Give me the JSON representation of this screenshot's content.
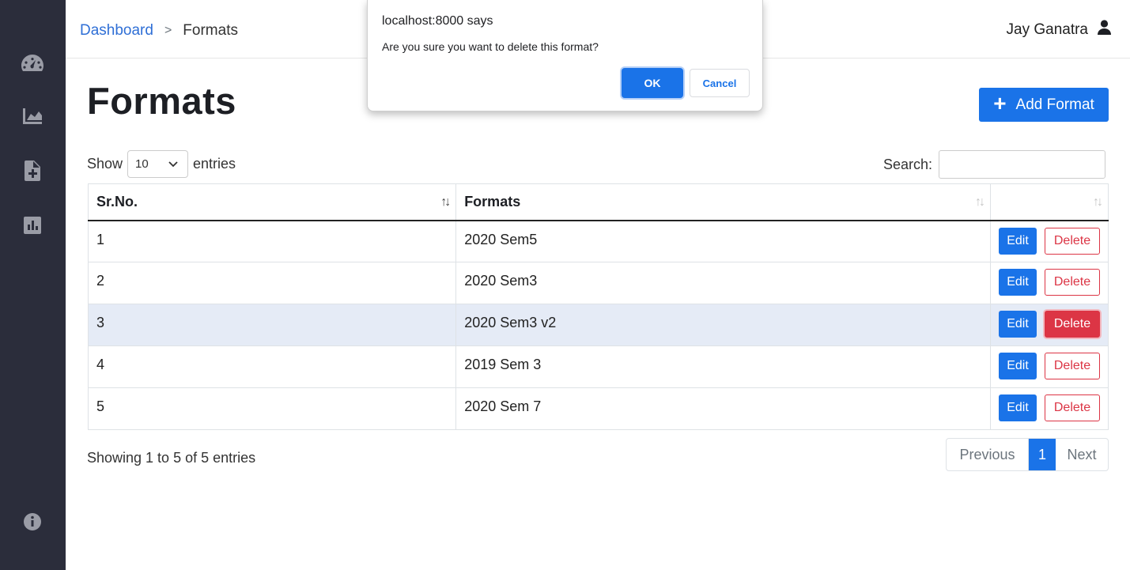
{
  "sidebar": {
    "icons": [
      "speedometer-icon",
      "area-chart-icon",
      "file-plus-icon",
      "bar-chart-icon",
      "info-icon"
    ]
  },
  "topbar": {
    "breadcrumb": {
      "link": "Dashboard",
      "separator": ">",
      "current": "Formats"
    },
    "user_name": "Jay Ganatra"
  },
  "page": {
    "title": "Formats",
    "add_button": "Add Format"
  },
  "table_controls": {
    "show_label": "Show",
    "entries_value": "10",
    "entries_label": "entries",
    "search_label": "Search:",
    "search_value": ""
  },
  "table": {
    "headers": [
      "Sr.No.",
      "Formats",
      ""
    ],
    "rows": [
      {
        "sr": "1",
        "format": "2020 Sem5",
        "edit": "Edit",
        "delete": "Delete"
      },
      {
        "sr": "2",
        "format": "2020 Sem3",
        "edit": "Edit",
        "delete": "Delete"
      },
      {
        "sr": "3",
        "format": "2020 Sem3 v2",
        "edit": "Edit",
        "delete": "Delete"
      },
      {
        "sr": "4",
        "format": "2019 Sem 3",
        "edit": "Edit",
        "delete": "Delete"
      },
      {
        "sr": "5",
        "format": "2020 Sem 7",
        "edit": "Edit",
        "delete": "Delete"
      }
    ],
    "selected_row": 3
  },
  "footer": {
    "info": "Showing 1 to 5 of 5 entries",
    "previous": "Previous",
    "page": "1",
    "next": "Next"
  },
  "dialog": {
    "title": "localhost:8000 says",
    "message": "Are you sure you want to delete this format?",
    "ok": "OK",
    "cancel": "Cancel"
  },
  "colors": {
    "sidebar_bg": "#2b2d3b",
    "primary": "#1a73e8",
    "danger": "#dc3545",
    "selected_row": "#e5ebf6"
  }
}
